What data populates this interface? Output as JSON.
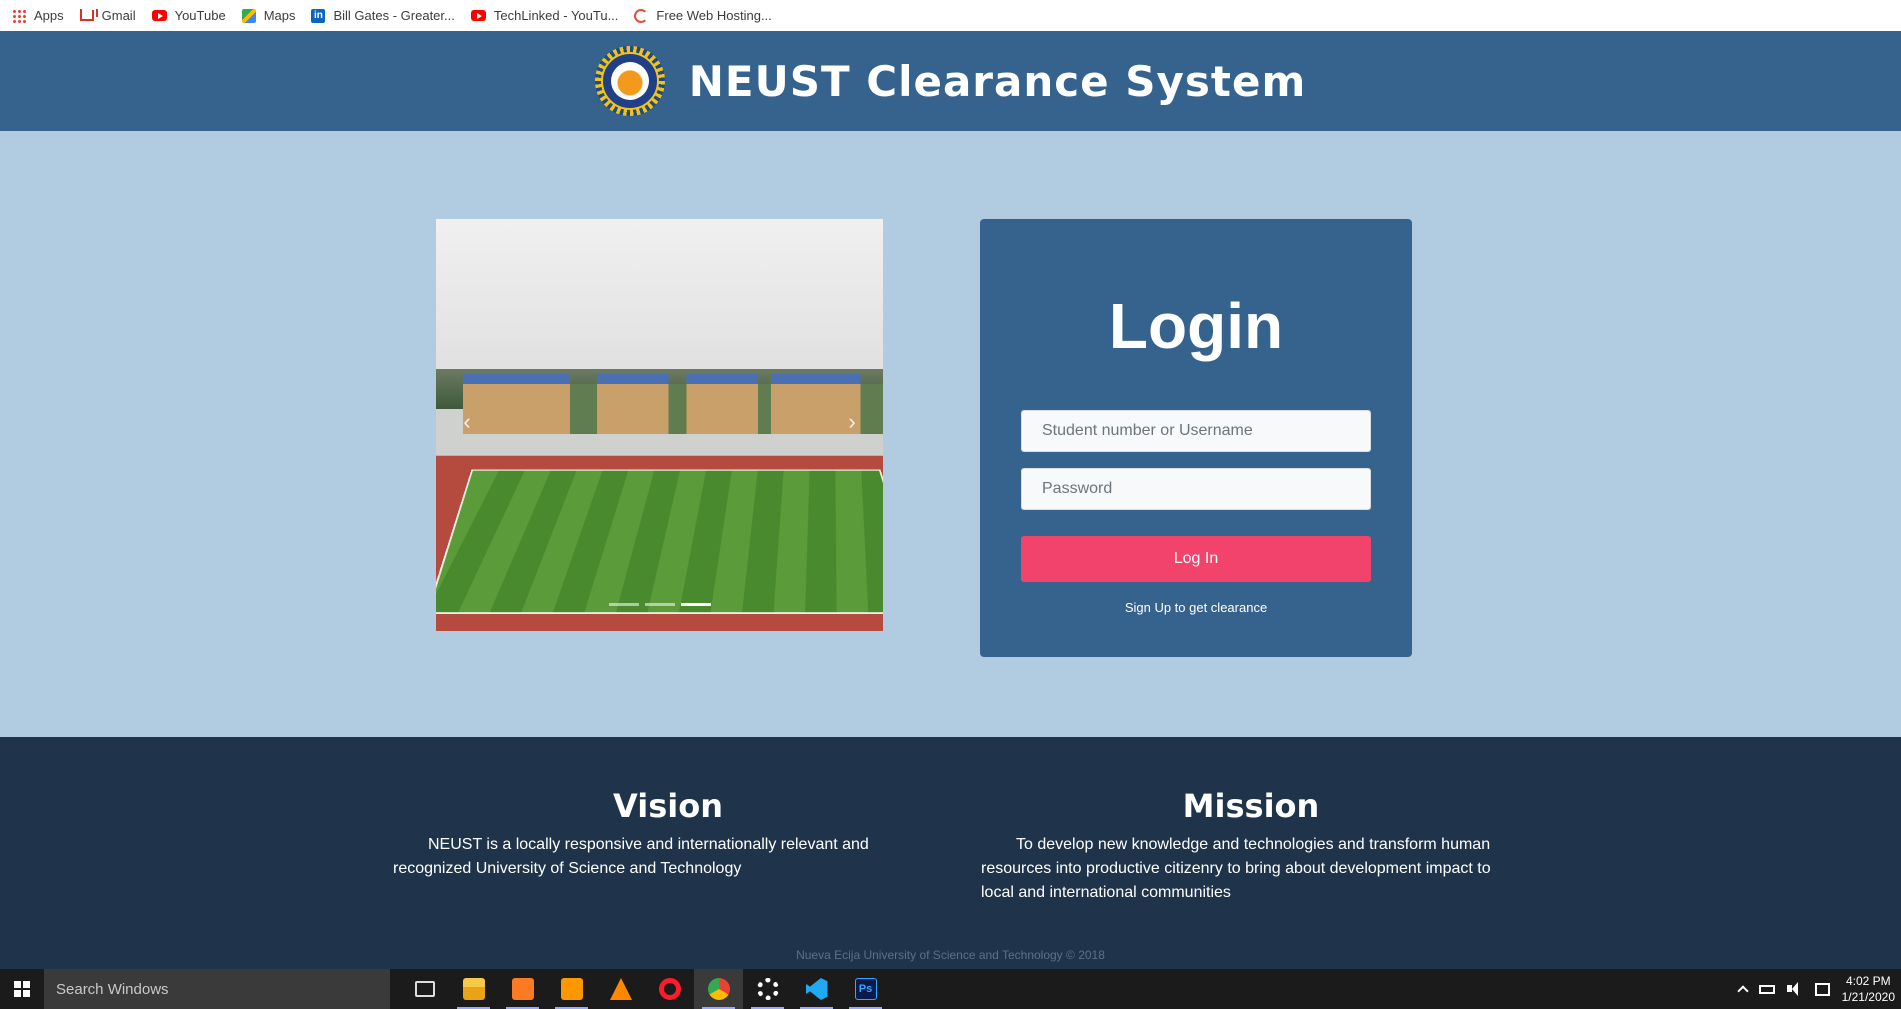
{
  "bookmarks": [
    {
      "label": "Apps",
      "icon": "apps-grid-icon"
    },
    {
      "label": "Gmail",
      "icon": "gmail-icon"
    },
    {
      "label": "YouTube",
      "icon": "youtube-icon"
    },
    {
      "label": "Maps",
      "icon": "maps-icon"
    },
    {
      "label": "Bill Gates - Greater...",
      "icon": "linkedin-icon"
    },
    {
      "label": "TechLinked - YouTu...",
      "icon": "youtube-icon"
    },
    {
      "label": "Free Web Hosting...",
      "icon": "web-hosting-icon"
    }
  ],
  "header": {
    "title": "NEUST Clearance System",
    "logo": "neust-seal-logo"
  },
  "carousel": {
    "prev_icon": "‹",
    "next_icon": "›",
    "slides": 3,
    "active_slide": 3
  },
  "login": {
    "title": "Login",
    "username_placeholder": "Student number or Username",
    "password_placeholder": "Password",
    "button_label": "Log In",
    "signup_link": "Sign Up to get clearance"
  },
  "footer": {
    "vision": {
      "heading": "Vision",
      "text": "NEUST is a locally responsive and internationally relevant and recognized University of Science and Technology"
    },
    "mission": {
      "heading": "Mission",
      "text": "To develop new knowledge and technologies and transform human resources into productive citizenry to bring about development impact to local and international communities"
    },
    "copyright": "Nueva Ecija University of Science and Technology © 2018"
  },
  "taskbar": {
    "search_placeholder": "Search Windows",
    "apps": [
      "task-view",
      "file-explorer",
      "xampp",
      "sublime-text",
      "vlc",
      "opera",
      "chrome",
      "settings",
      "vscode",
      "photoshop"
    ],
    "time": "4:02 PM",
    "date": "1/21/2020"
  },
  "colors": {
    "header": "#36638e",
    "page_bg": "#b1cce0",
    "card": "#36638e",
    "button": "#f2436c",
    "footer": "#1f344a"
  }
}
